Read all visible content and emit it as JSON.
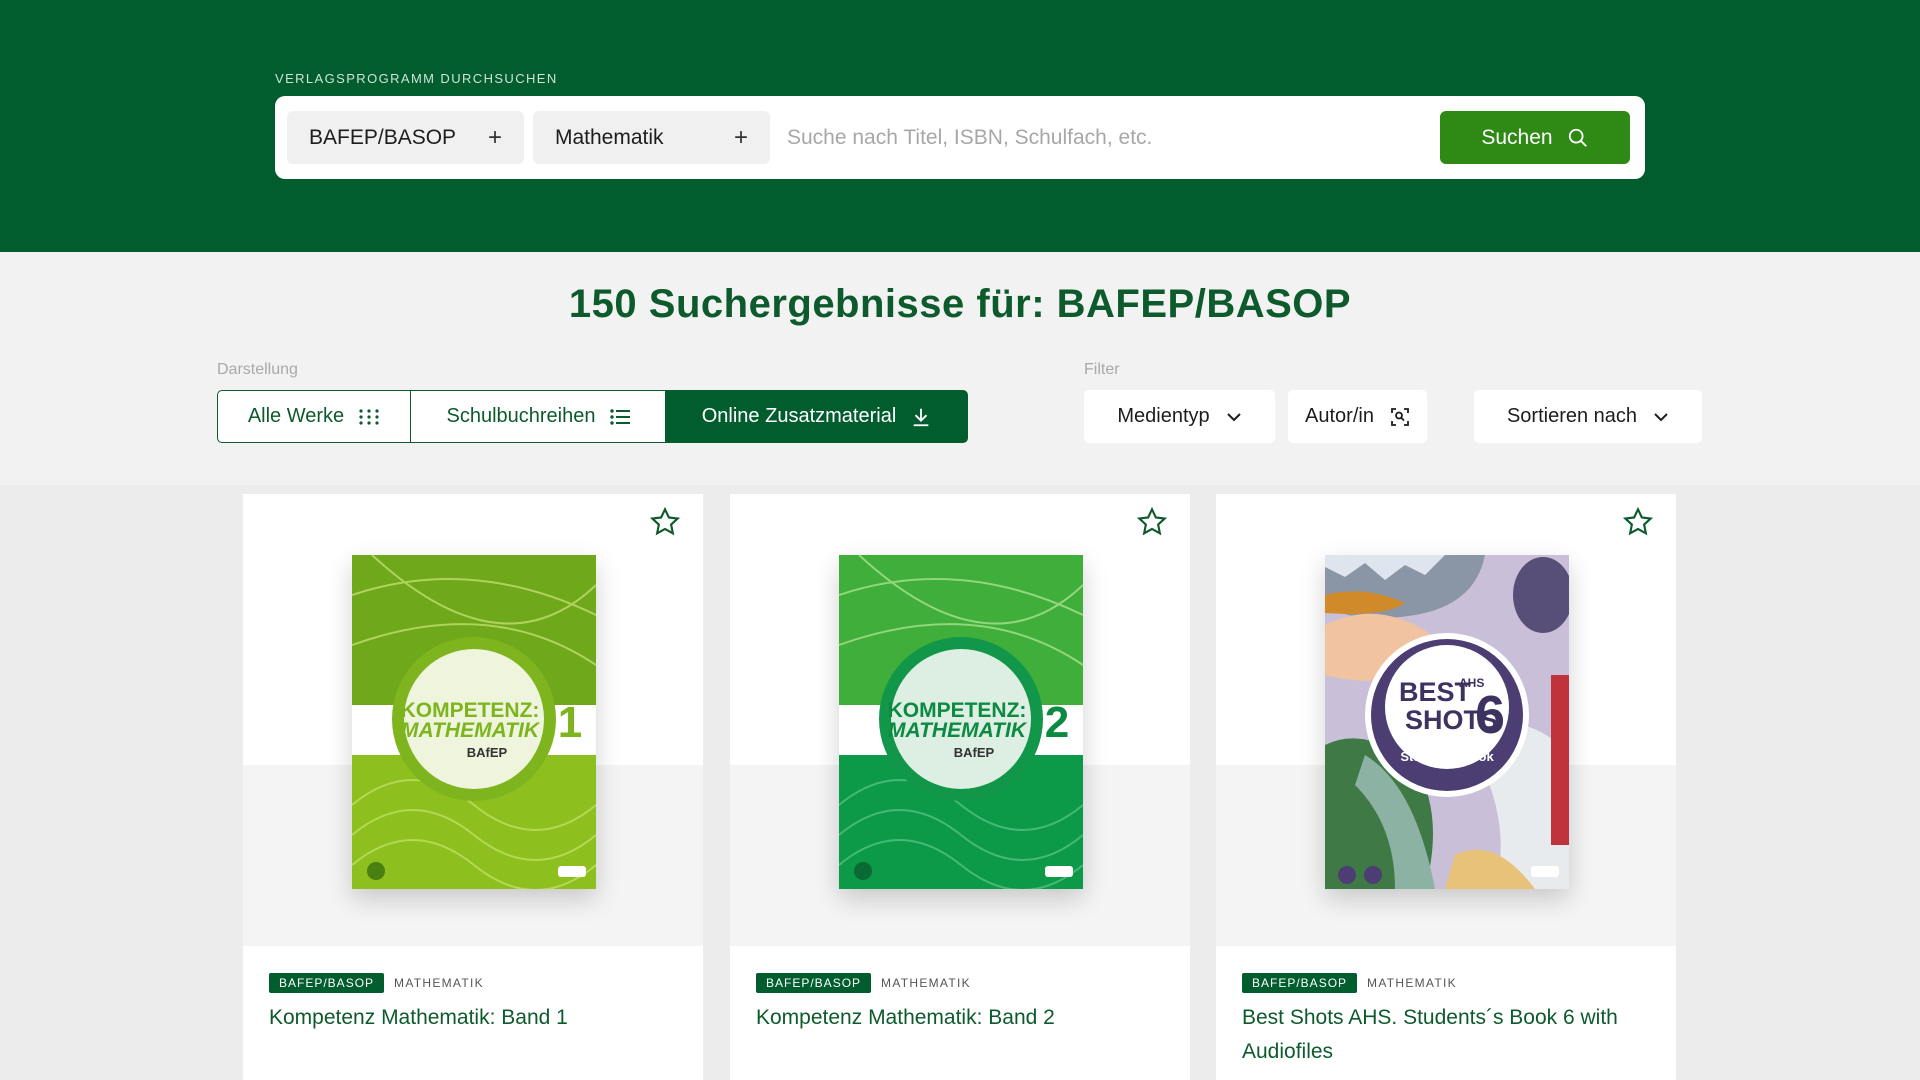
{
  "header": {
    "search_label": "VERLAGSPROGRAMM DURCHSUCHEN",
    "chips": [
      {
        "label": "BAFEP/BASOP",
        "icon": "plus-icon"
      },
      {
        "label": "Mathematik",
        "icon": "plus-icon"
      }
    ],
    "search_placeholder": "Suche nach Titel, ISBN, Schulfach, etc.",
    "search_button": "Suchen"
  },
  "results": {
    "title": "150 Suchergebnisse für: BAFEP/BASOP"
  },
  "view": {
    "label": "Darstellung",
    "options": [
      {
        "label": "Alle Werke",
        "icon": "grid-icon"
      },
      {
        "label": "Schulbuchreihen",
        "icon": "list-icon"
      },
      {
        "label": "Online Zusatzmaterial",
        "icon": "download-icon",
        "active": true
      }
    ]
  },
  "filter": {
    "label": "Filter",
    "options": [
      {
        "label": "Medientyp",
        "icon": "chevron-down-icon"
      },
      {
        "label": "Autor/in",
        "icon": "person-search-icon"
      },
      {
        "label": "Sortieren nach",
        "icon": "chevron-down-icon"
      }
    ]
  },
  "colors": {
    "brand_dark": "#015c2e",
    "brand_button": "#2e8a14"
  },
  "cards": [
    {
      "badge": "BAFEP/BASOP",
      "subject": "MATHEMATIK",
      "title": "Kompetenz Mathematik: Band 1",
      "cover": {
        "line1": "KOMPETENZ:",
        "line2": "MATHEMATIK",
        "line3": "BAfEP",
        "number": "1"
      }
    },
    {
      "badge": "BAFEP/BASOP",
      "subject": "MATHEMATIK",
      "title": "Kompetenz Mathematik: Band 2",
      "cover": {
        "line1": "KOMPETENZ:",
        "line2": "MATHEMATIK",
        "line3": "BAfEP",
        "number": "2"
      }
    },
    {
      "badge": "BAFEP/BASOP",
      "subject": "MATHEMATIK",
      "title": "Best Shots AHS. Students´s Book 6 with Audiofiles",
      "cover": {
        "line1": "BEST",
        "line1_sup": "AHS",
        "line2": "SHOTS",
        "number": "6",
        "line3": "Student's book"
      }
    }
  ]
}
